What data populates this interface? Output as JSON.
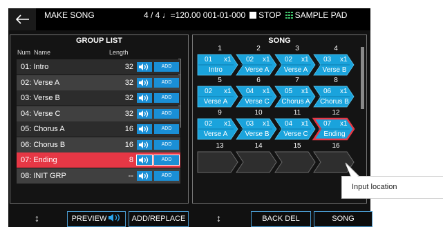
{
  "header": {
    "title": "MAKE SONG",
    "status": "4 / 4 ♩=120.00  001-01-000",
    "stop_label": "STOP",
    "sample_pad_label": "SAMPLE PAD"
  },
  "group_list": {
    "title": "GROUP LIST",
    "col_num": "Num",
    "col_name": "Name",
    "col_length": "Length",
    "add_label": "ADD",
    "rows": [
      {
        "name": "01: Intro",
        "length": "32"
      },
      {
        "name": "02: Verse A",
        "length": "32"
      },
      {
        "name": "03: Verse B",
        "length": "32"
      },
      {
        "name": "04: Verse C",
        "length": "32"
      },
      {
        "name": "05: Chorus A",
        "length": "16"
      },
      {
        "name": "06: Chorus B",
        "length": "16"
      },
      {
        "name": "07: Ending",
        "length": "8"
      },
      {
        "name": "08: INIT GRP",
        "length": "--"
      }
    ],
    "selected_index": 6
  },
  "song": {
    "title": "SONG",
    "slot_numbers": [
      "1",
      "2",
      "3",
      "4",
      "5",
      "6",
      "7",
      "8",
      "9",
      "10",
      "11",
      "12",
      "13",
      "14",
      "15",
      "16"
    ],
    "slots": [
      {
        "group": "01",
        "repeat": "x1",
        "name": "Intro"
      },
      {
        "group": "02",
        "repeat": "x1",
        "name": "Verse A"
      },
      {
        "group": "02",
        "repeat": "x1",
        "name": "Verse A"
      },
      {
        "group": "03",
        "repeat": "x1",
        "name": "Verse B"
      },
      {
        "group": "02",
        "repeat": "x1",
        "name": "Verse A"
      },
      {
        "group": "04",
        "repeat": "x1",
        "name": "Verse C"
      },
      {
        "group": "05",
        "repeat": "x1",
        "name": "Chorus A"
      },
      {
        "group": "06",
        "repeat": "x1",
        "name": "Chorus B"
      },
      {
        "group": "02",
        "repeat": "x1",
        "name": "Verse A"
      },
      {
        "group": "03",
        "repeat": "x1",
        "name": "Verse B"
      },
      {
        "group": "04",
        "repeat": "x1",
        "name": "Verse C"
      },
      {
        "group": "07",
        "repeat": "x1",
        "name": "Ending"
      }
    ],
    "cursor_index": 11
  },
  "buttons": {
    "preview": "PREVIEW",
    "add_replace": "ADD/REPLACE",
    "back_del": "BACK DEL",
    "song": "SONG"
  },
  "callout": "Input location",
  "colors": {
    "accent": "#1a8fd6",
    "selected": "#e63745",
    "background": "#111111"
  }
}
